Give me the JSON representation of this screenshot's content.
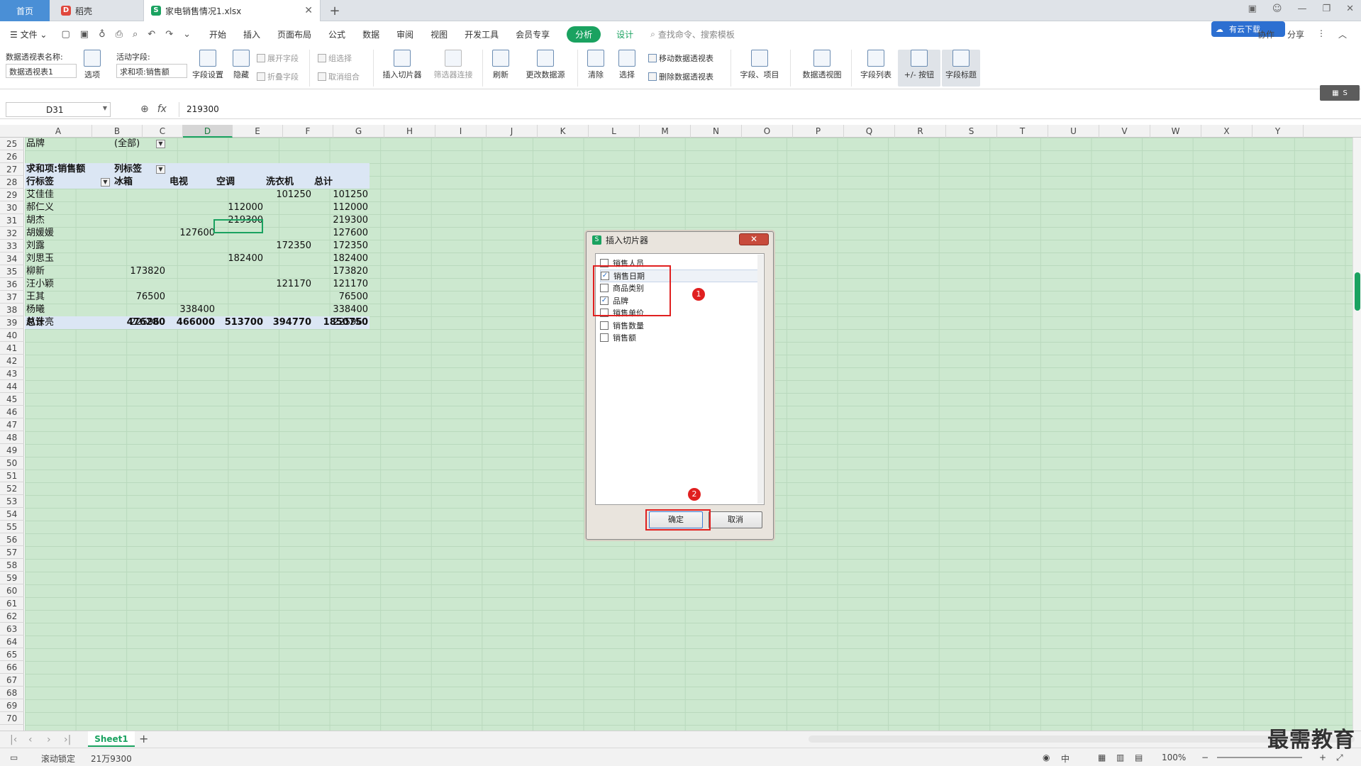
{
  "tabs": {
    "home": "首页",
    "daoke": "稻壳",
    "file": "家电销售情况1.xlsx"
  },
  "menu": {
    "file": "文件",
    "items": [
      "开始",
      "插入",
      "页面布局",
      "公式",
      "数据",
      "审阅",
      "视图",
      "开发工具",
      "会员专享"
    ],
    "analyze": "分析",
    "design": "设计",
    "search": "查找命令、搜索模板",
    "cloud": "有云下载",
    "right": [
      "协作",
      "分享"
    ]
  },
  "ribbon": {
    "pt_name_label": "数据透视表名称:",
    "pt_name_value": "数据透视表1",
    "options": "选项",
    "active_field_label": "活动字段:",
    "active_field_value": "求和项:销售额",
    "field_settings": "字段设置",
    "hide": "隐藏",
    "expand": "展开字段",
    "collapse": "折叠字段",
    "group_sel": "组选择",
    "ungroup": "取消组合",
    "insert_slicer": "插入切片器",
    "filter_conn": "筛选器连接",
    "refresh": "刷新",
    "change_source": "更改数据源",
    "clear": "清除",
    "select": "选择",
    "move_pt": "移动数据透视表",
    "delete_pt": "删除数据透视表",
    "fields_items": "字段、项目",
    "pivot_chart": "数据透视图",
    "field_list": "字段列表",
    "plus_minus": "+/- 按钮",
    "field_headers": "字段标题"
  },
  "formula_bar": {
    "cell_ref": "D31",
    "value": "219300"
  },
  "columns": [
    "A",
    "B",
    "C",
    "D",
    "E",
    "F",
    "G",
    "H",
    "I",
    "J",
    "K",
    "L",
    "M",
    "N",
    "O",
    "P",
    "Q",
    "R",
    "S",
    "T",
    "U",
    "V",
    "W",
    "X",
    "Y"
  ],
  "rows": [
    "25",
    "26",
    "27",
    "28",
    "29",
    "30",
    "31",
    "32",
    "33",
    "34",
    "35",
    "36",
    "37",
    "38",
    "39",
    "40",
    "41",
    "42",
    "43",
    "44",
    "45",
    "46",
    "47",
    "48",
    "49",
    "50",
    "51",
    "52",
    "53",
    "54",
    "55",
    "56",
    "57",
    "58",
    "59",
    "60",
    "61",
    "62",
    "63",
    "64",
    "65",
    "66",
    "67",
    "68",
    "69",
    "70"
  ],
  "pivot": {
    "filter_label": "品牌",
    "filter_value": "(全部)",
    "sum_label": "求和项:销售额",
    "col_label": "列标签",
    "row_label": "行标签",
    "headers": [
      "冰箱",
      "电视",
      "空调",
      "洗衣机",
      "总计"
    ],
    "rows": [
      {
        "name": "艾佳佳",
        "v": [
          "",
          "",
          "",
          "101250",
          "101250"
        ]
      },
      {
        "name": "郝仁义",
        "v": [
          "",
          "",
          "112000",
          "",
          "112000"
        ]
      },
      {
        "name": "胡杰",
        "v": [
          "",
          "",
          "219300",
          "",
          "219300"
        ]
      },
      {
        "name": "胡媛媛",
        "v": [
          "",
          "127600",
          "",
          "",
          "127600"
        ]
      },
      {
        "name": "刘露",
        "v": [
          "",
          "",
          "",
          "172350",
          "172350"
        ]
      },
      {
        "name": "刘思玉",
        "v": [
          "",
          "",
          "182400",
          "",
          "182400"
        ]
      },
      {
        "name": "柳新",
        "v": [
          "173820",
          "",
          "",
          "",
          "173820"
        ]
      },
      {
        "name": "汪小颖",
        "v": [
          "",
          "",
          "",
          "121170",
          "121170"
        ]
      },
      {
        "name": "王其",
        "v": [
          "76500",
          "",
          "",
          "",
          "76500"
        ]
      },
      {
        "name": "杨曦",
        "v": [
          "",
          "338400",
          "",
          "",
          "338400"
        ]
      },
      {
        "name": "赵东亮",
        "v": [
          "225960",
          "",
          "",
          "",
          "225960"
        ]
      }
    ],
    "total_label": "总计",
    "totals": [
      "476280",
      "466000",
      "513700",
      "394770",
      "1850750"
    ]
  },
  "dialog": {
    "title": "插入切片器",
    "options": [
      {
        "label": "销售人员",
        "checked": false
      },
      {
        "label": "销售日期",
        "checked": true
      },
      {
        "label": "商品类别",
        "checked": false
      },
      {
        "label": "品牌",
        "checked": true
      },
      {
        "label": "销售单价",
        "checked": false
      },
      {
        "label": "销售数量",
        "checked": false
      },
      {
        "label": "销售额",
        "checked": false
      }
    ],
    "ok": "确定",
    "cancel": "取消",
    "badges": [
      "1",
      "2"
    ]
  },
  "sheet": {
    "name": "Sheet1"
  },
  "status": {
    "scroll_lock": "滚动锁定",
    "sum": "21万9300",
    "zoom": "100%",
    "input": "中"
  },
  "watermark": "最需教育",
  "colors": {
    "accent": "#1aa260",
    "grid_bg": "#cce8cf",
    "home_tab": "#4a8fd6",
    "annotation": "#e02020"
  }
}
